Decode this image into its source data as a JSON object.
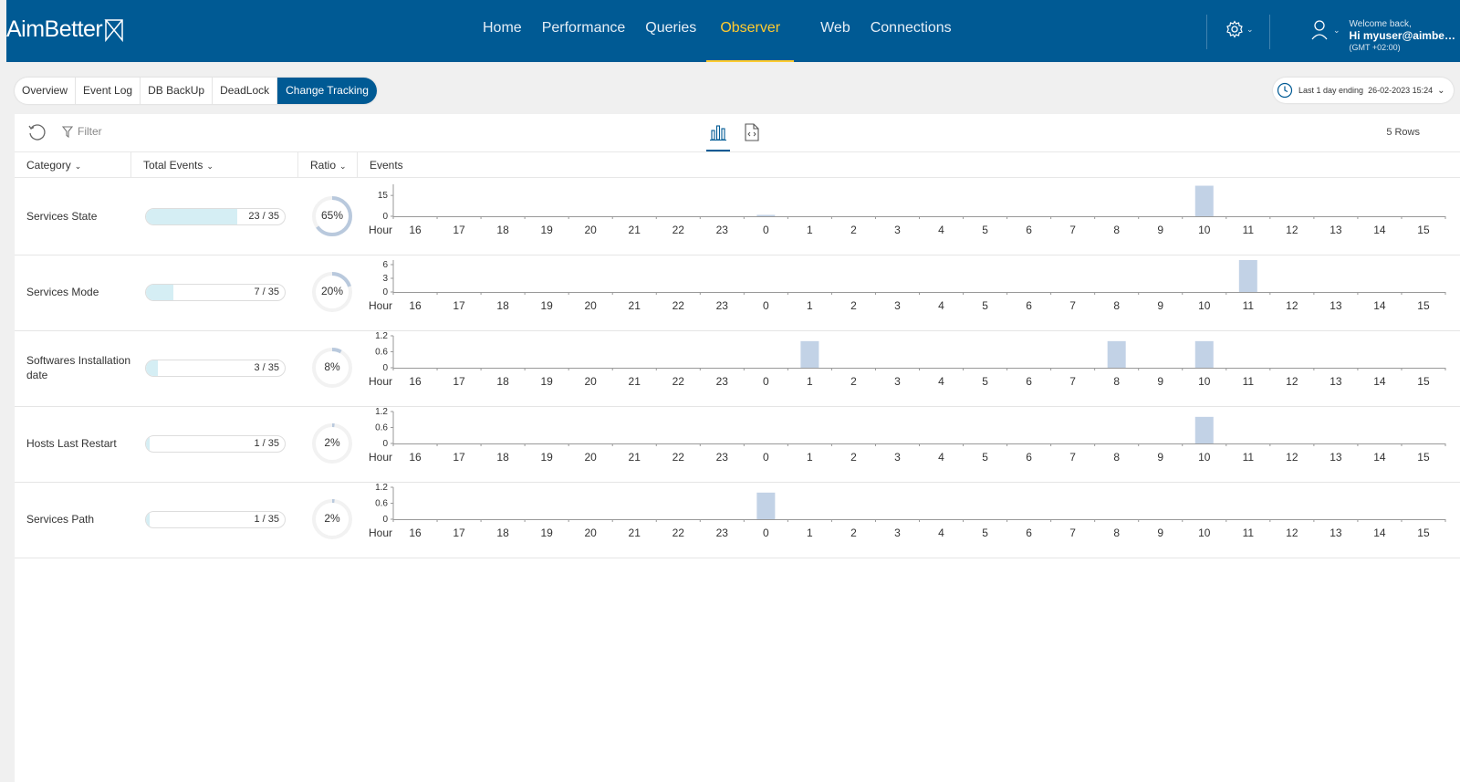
{
  "app": {
    "logo": "AimBetter",
    "nav": [
      {
        "label": "Home",
        "active": false
      },
      {
        "label": "Performance",
        "active": false
      },
      {
        "label": "Queries",
        "active": false
      },
      {
        "label": "Observer",
        "active": true
      },
      {
        "label": "Web",
        "active": false
      },
      {
        "label": "Connections",
        "active": false
      }
    ],
    "user": {
      "welcome": "Welcome back,",
      "name": "Hi myuser@aimbetter...",
      "timezone": "(GMT +02:00)"
    }
  },
  "subtabs": [
    {
      "label": "Overview",
      "active": false
    },
    {
      "label": "Event Log",
      "active": false
    },
    {
      "label": "DB BackUp",
      "active": false
    },
    {
      "label": "DeadLock",
      "active": false
    },
    {
      "label": "Change Tracking",
      "active": true
    }
  ],
  "daterange": {
    "label": "Last 1 day ending",
    "date": "26-02-2023 15:24"
  },
  "toolbar": {
    "filter_label": "Filter",
    "rows_label": "5 Rows"
  },
  "columns": {
    "category": "Category",
    "total_events": "Total Events",
    "ratio": "Ratio",
    "events": "Events"
  },
  "colors": {
    "nav_bg": "#005a94",
    "accent": "#ffcb2f",
    "bar_fill": "#d5eef4",
    "event_bar": "#c2d2e6",
    "ring": "#b9c9dd"
  },
  "axis_label": "Hour",
  "chart_data": {
    "type": "bar",
    "categories": [
      "16",
      "17",
      "18",
      "19",
      "20",
      "21",
      "22",
      "23",
      "0",
      "1",
      "2",
      "3",
      "4",
      "5",
      "6",
      "7",
      "8",
      "9",
      "10",
      "11",
      "12",
      "13",
      "14",
      "15"
    ],
    "rows": [
      {
        "category": "Services State",
        "total": 23,
        "total_max": 35,
        "total_label": "23 / 35",
        "ratio": 65,
        "ratio_label": "65%",
        "yticks": [
          "15",
          "0"
        ],
        "ylim": [
          0,
          23
        ],
        "values": [
          0,
          0,
          0,
          0,
          0,
          0,
          0,
          0,
          1,
          0,
          0,
          0,
          0,
          0,
          0,
          0,
          0,
          0,
          22,
          0,
          0,
          0,
          0,
          0
        ]
      },
      {
        "category": "Services Mode",
        "total": 7,
        "total_max": 35,
        "total_label": "7 / 35",
        "ratio": 20,
        "ratio_label": "20%",
        "yticks": [
          "6",
          "3",
          "0"
        ],
        "ylim": [
          0,
          7
        ],
        "values": [
          0,
          0,
          0,
          0,
          0,
          0,
          0,
          0,
          0,
          0,
          0,
          0,
          0,
          0,
          0,
          0,
          0,
          0,
          0,
          7,
          0,
          0,
          0,
          0
        ]
      },
      {
        "category": "Softwares Installation date",
        "total": 3,
        "total_max": 35,
        "total_label": "3 / 35",
        "ratio": 8,
        "ratio_label": "8%",
        "yticks": [
          "1.2",
          "0.6",
          "0"
        ],
        "ylim": [
          0,
          1.2
        ],
        "values": [
          0,
          0,
          0,
          0,
          0,
          0,
          0,
          0,
          0,
          1,
          0,
          0,
          0,
          0,
          0,
          0,
          1,
          0,
          1,
          0,
          0,
          0,
          0,
          0
        ]
      },
      {
        "category": "Hosts Last Restart",
        "total": 1,
        "total_max": 35,
        "total_label": "1 / 35",
        "ratio": 2,
        "ratio_label": "2%",
        "yticks": [
          "1.2",
          "0.6",
          "0"
        ],
        "ylim": [
          0,
          1.2
        ],
        "values": [
          0,
          0,
          0,
          0,
          0,
          0,
          0,
          0,
          0,
          0,
          0,
          0,
          0,
          0,
          0,
          0,
          0,
          0,
          1,
          0,
          0,
          0,
          0,
          0
        ]
      },
      {
        "category": "Services Path",
        "total": 1,
        "total_max": 35,
        "total_label": "1 / 35",
        "ratio": 2,
        "ratio_label": "2%",
        "yticks": [
          "1.2",
          "0.6",
          "0"
        ],
        "ylim": [
          0,
          1.2
        ],
        "values": [
          0,
          0,
          0,
          0,
          0,
          0,
          0,
          0,
          1,
          0,
          0,
          0,
          0,
          0,
          0,
          0,
          0,
          0,
          0,
          0,
          0,
          0,
          0,
          0
        ]
      }
    ]
  }
}
